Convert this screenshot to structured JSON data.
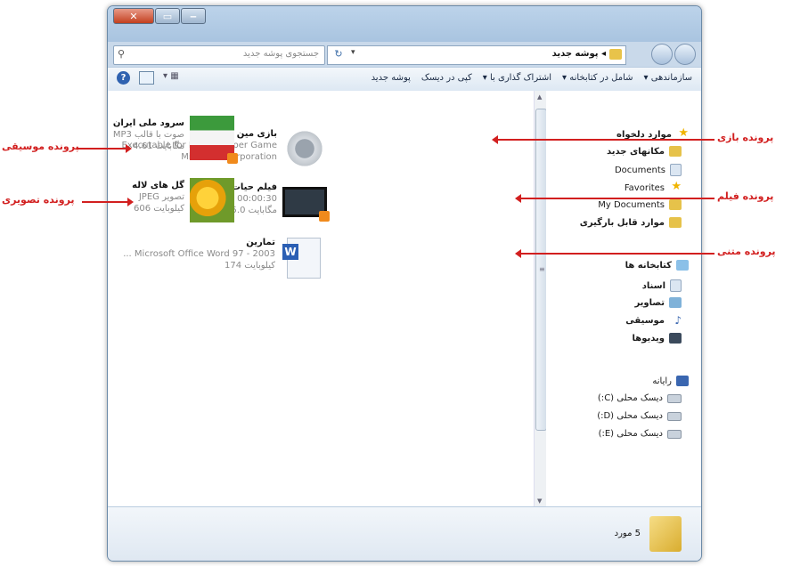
{
  "address_bar": {
    "path": "پوشه جدید",
    "separator": "◂"
  },
  "search": {
    "placeholder": "جستجوی پوشه جدید"
  },
  "toolbar": {
    "organize": "سازماندهی ▾",
    "include_library": "شامل در کتابخانه ▾",
    "share_with": "اشتراک گذاری با ▾",
    "burn": "کپی در دیسک",
    "new_folder": "پوشه جدید"
  },
  "nav_pane": {
    "favorites": "موارد دلخواه",
    "recent_places": "مکانهای جدید",
    "documents1": "Documents",
    "favorites_en": "Favorites",
    "my_documents": "My Documents",
    "downloads": "موارد قابل بارگیری",
    "libraries": "کتابخانه ها",
    "docs": "اسناد",
    "pictures": "تصاویر",
    "music": "موسیقی",
    "videos": "ویدیوها",
    "computer": "رایانه",
    "drive_c": "دیسک محلی (C:)",
    "drive_d": "دیسک محلی (D:)",
    "drive_e": "دیسک محلی (E:)"
  },
  "files": [
    {
      "name": "بازی مین یابی",
      "line2": "Executable for Minesweeper Game",
      "line3": "Microsoft Corporation",
      "icon": "gear-icon"
    },
    {
      "name": "فیلم حیات وحش",
      "line2": "00:00:30",
      "line3": "مگابایت 25.0",
      "icon": "film-icon"
    },
    {
      "name": "تمارین",
      "line2": "Microsoft Office Word 97 - 2003 ...",
      "line3": "کیلوبایت 174",
      "icon": "word-icon"
    },
    {
      "name": "سرود ملی ایران",
      "line2": "صوت با قالب MP3",
      "line3": "مگابایت 4.61",
      "icon": "flag-icon"
    },
    {
      "name": "گل های لاله",
      "line2": "تصویر JPEG",
      "line3": "کیلوبایت 606",
      "icon": "flower-icon"
    }
  ],
  "status": {
    "count": "5 مورد"
  },
  "callouts": {
    "game": "پرونده بازی",
    "film": "پرونده فیلم",
    "text": "پرونده متنی",
    "music": "پرونده موسیقی",
    "image": "پرونده تصویری"
  },
  "colors": {
    "callout": "#d21f1f",
    "chrome": "#c9d9ea"
  }
}
